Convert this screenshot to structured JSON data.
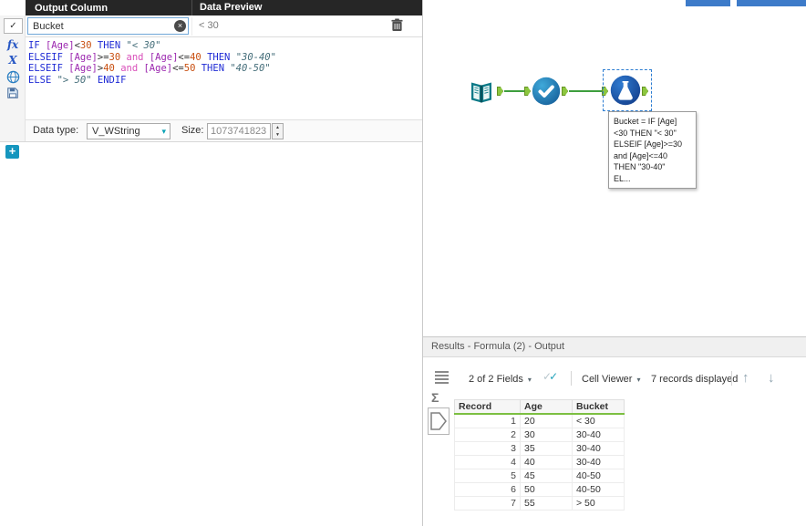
{
  "icons": {
    "caret_down": "▾",
    "clear": "×",
    "selector_check": "✓",
    "plus": "+",
    "fx": "fx",
    "x_var": "X",
    "sigma": "Σ",
    "spin_up": "▲",
    "spin_down": "▼",
    "arrow_up": "↑",
    "arrow_down": "↓",
    "check": "✓"
  },
  "formula_panel": {
    "header": {
      "output_column": "Output Column",
      "data_preview": "Data Preview"
    },
    "expression": {
      "name": "Bucket",
      "preview": "< 30"
    },
    "code_lines": [
      [
        {
          "t": "IF ",
          "c": "kw"
        },
        {
          "t": "[Age]",
          "c": "fld"
        },
        {
          "t": "<",
          "c": "op"
        },
        {
          "t": "30",
          "c": "num"
        },
        {
          "t": " ",
          "c": "op"
        },
        {
          "t": "THEN",
          "c": "kw"
        },
        {
          "t": " ",
          "c": "op"
        },
        {
          "t": "\"< 30\"",
          "c": "str"
        }
      ],
      [
        {
          "t": "ELSEIF ",
          "c": "kw"
        },
        {
          "t": "[Age]",
          "c": "fld"
        },
        {
          "t": ">=",
          "c": "op"
        },
        {
          "t": "30",
          "c": "num"
        },
        {
          "t": " ",
          "c": "op"
        },
        {
          "t": "and",
          "c": "lop"
        },
        {
          "t": " ",
          "c": "op"
        },
        {
          "t": "[Age]",
          "c": "fld"
        },
        {
          "t": "<=",
          "c": "op"
        },
        {
          "t": "40",
          "c": "num"
        },
        {
          "t": " ",
          "c": "op"
        },
        {
          "t": "THEN",
          "c": "kw"
        },
        {
          "t": " ",
          "c": "op"
        },
        {
          "t": "\"30-40\"",
          "c": "str"
        }
      ],
      [
        {
          "t": "ELSEIF ",
          "c": "kw"
        },
        {
          "t": "[Age]",
          "c": "fld"
        },
        {
          "t": ">",
          "c": "op"
        },
        {
          "t": "40",
          "c": "num"
        },
        {
          "t": " ",
          "c": "op"
        },
        {
          "t": "and",
          "c": "lop"
        },
        {
          "t": " ",
          "c": "op"
        },
        {
          "t": "[Age]",
          "c": "fld"
        },
        {
          "t": "<=",
          "c": "op"
        },
        {
          "t": "50",
          "c": "num"
        },
        {
          "t": " ",
          "c": "op"
        },
        {
          "t": "THEN",
          "c": "kw"
        },
        {
          "t": " ",
          "c": "op"
        },
        {
          "t": "\"40-50\"",
          "c": "str"
        }
      ],
      [
        {
          "t": "ELSE ",
          "c": "kw"
        },
        {
          "t": "\"> 50\"",
          "c": "str"
        },
        {
          "t": " ",
          "c": "op"
        },
        {
          "t": "ENDIF",
          "c": "kw"
        }
      ]
    ],
    "datatype": {
      "label": "Data type:",
      "value": "V_WString",
      "size_label": "Size:",
      "size_value": "1073741823"
    }
  },
  "canvas": {
    "annotation": "Bucket = IF [Age]\n<30 THEN \"< 30\"\nELSEIF [Age]>=30\nand [Age]<=40\nTHEN \"30-40\"\nEL..."
  },
  "results": {
    "title": "Results - Formula (2) - Output",
    "toolbar": {
      "fields": "2 of 2 Fields",
      "cell_viewer": "Cell Viewer",
      "records": "7 records displayed"
    },
    "table": {
      "columns": [
        "Record",
        "Age",
        "Bucket"
      ],
      "rows": [
        [
          "1",
          "20",
          "< 30"
        ],
        [
          "2",
          "30",
          "30-40"
        ],
        [
          "3",
          "35",
          "30-40"
        ],
        [
          "4",
          "40",
          "30-40"
        ],
        [
          "5",
          "45",
          "40-50"
        ],
        [
          "6",
          "50",
          "40-50"
        ],
        [
          "7",
          "55",
          "> 50"
        ]
      ]
    }
  }
}
